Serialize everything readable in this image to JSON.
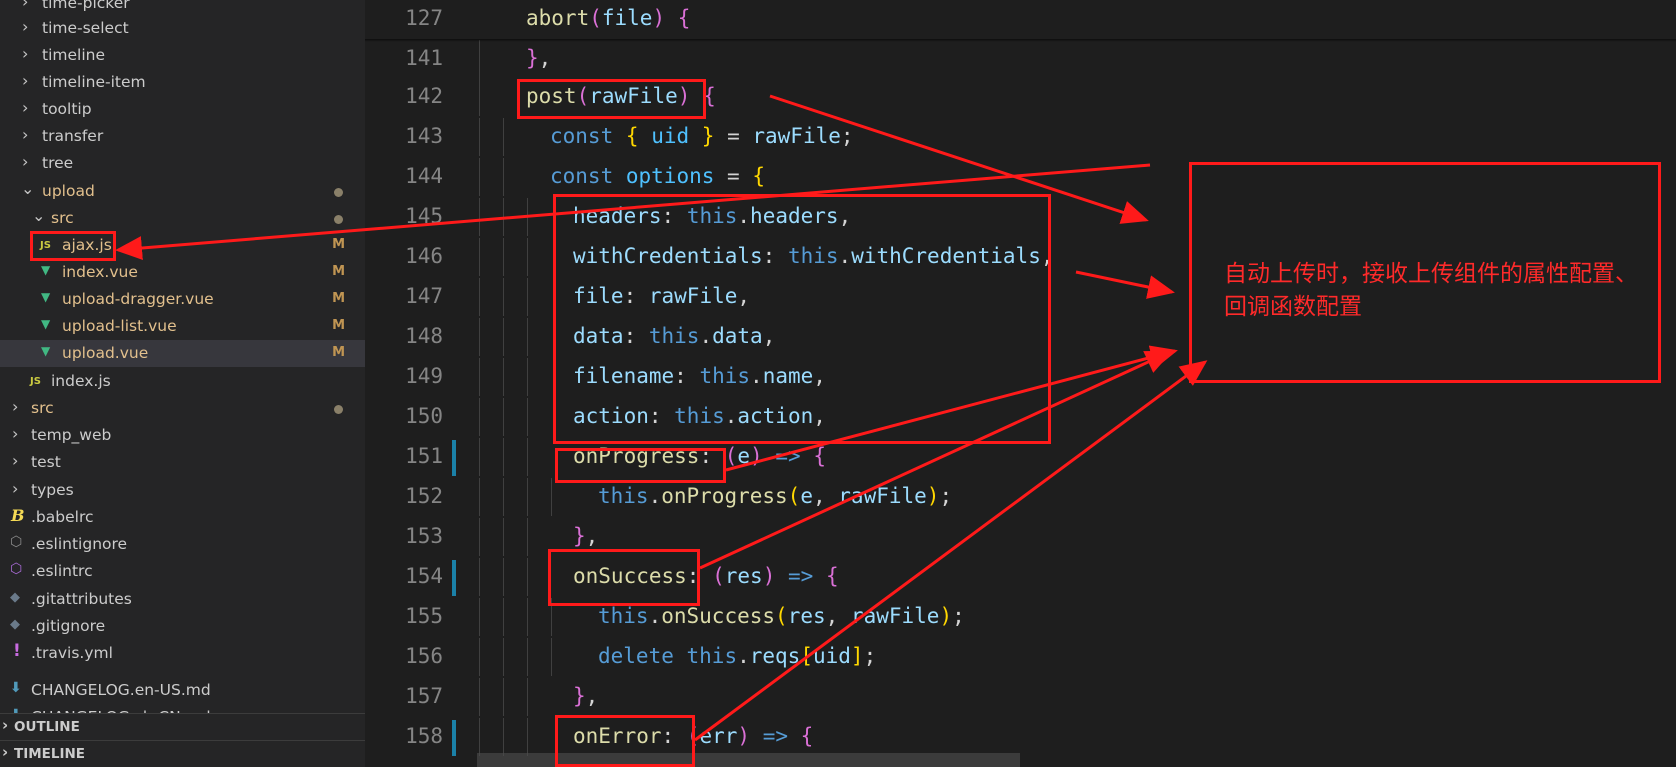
{
  "explorer": {
    "items": [
      {
        "label": "time-picker",
        "kind": "folder"
      },
      {
        "label": "time-select",
        "kind": "folder"
      },
      {
        "label": "timeline",
        "kind": "folder"
      },
      {
        "label": "timeline-item",
        "kind": "folder"
      },
      {
        "label": "tooltip",
        "kind": "folder"
      },
      {
        "label": "transfer",
        "kind": "folder"
      },
      {
        "label": "tree",
        "kind": "folder"
      },
      {
        "label": "upload",
        "kind": "folder-open",
        "modified_dot": true
      },
      {
        "label": "src",
        "kind": "folder-open",
        "modified_dot": true
      },
      {
        "label": "ajax.js",
        "icon": "JS",
        "status": "M"
      },
      {
        "label": "index.vue",
        "icon": "vue",
        "status": "M"
      },
      {
        "label": "upload-dragger.vue",
        "icon": "vue",
        "status": "M"
      },
      {
        "label": "upload-list.vue",
        "icon": "vue",
        "status": "M"
      },
      {
        "label": "upload.vue",
        "icon": "vue",
        "status": "M",
        "selected": true
      },
      {
        "label": "index.js",
        "icon": "JS"
      },
      {
        "label": "src",
        "kind": "folder",
        "modified_dot": true
      },
      {
        "label": "temp_web",
        "kind": "folder"
      },
      {
        "label": "test",
        "kind": "folder"
      },
      {
        "label": "types",
        "kind": "folder"
      },
      {
        "label": ".babelrc",
        "icon": "babel"
      },
      {
        "label": ".eslintignore",
        "icon": "eslint"
      },
      {
        "label": ".eslintrc",
        "icon": "eslint"
      },
      {
        "label": ".gitattributes",
        "icon": "git"
      },
      {
        "label": ".gitignore",
        "icon": "git"
      },
      {
        "label": ".travis.yml",
        "icon": "yml"
      },
      {
        "label": "CHANGELOG.en-US.md",
        "icon": "md"
      },
      {
        "label": "CHANGELOG.zh-CN.md",
        "icon": "md"
      }
    ],
    "outline_label": "OUTLINE",
    "timeline_label": "TIMELINE",
    "status_modified": "M"
  },
  "editor": {
    "sticky_line": {
      "num": "127",
      "text": "abort(file) {"
    },
    "lines": [
      {
        "num": "141",
        "text": "},"
      },
      {
        "num": "142",
        "text": "post(rawFile) {"
      },
      {
        "num": "143",
        "text": "const { uid } = rawFile;"
      },
      {
        "num": "144",
        "text": "const options = {"
      },
      {
        "num": "145",
        "text": "headers: this.headers,"
      },
      {
        "num": "146",
        "text": "withCredentials: this.withCredentials,"
      },
      {
        "num": "147",
        "text": "file: rawFile,"
      },
      {
        "num": "148",
        "text": "data: this.data,"
      },
      {
        "num": "149",
        "text": "filename: this.name,"
      },
      {
        "num": "150",
        "text": "action: this.action,"
      },
      {
        "num": "151",
        "text": "onProgress: (e) => {"
      },
      {
        "num": "152",
        "text": "this.onProgress(e, rawFile);"
      },
      {
        "num": "153",
        "text": "},"
      },
      {
        "num": "154",
        "text": "onSuccess: (res) => {"
      },
      {
        "num": "155",
        "text": "this.onSuccess(res, rawFile);"
      },
      {
        "num": "156",
        "text": "delete this.reqs[uid];"
      },
      {
        "num": "157",
        "text": "},"
      },
      {
        "num": "158",
        "text": "onError: (err) => {"
      }
    ]
  },
  "annotation": {
    "note": "自动上传时，接收上传组件的属性配置、回调函数配置",
    "color": "#ff1a1a"
  }
}
